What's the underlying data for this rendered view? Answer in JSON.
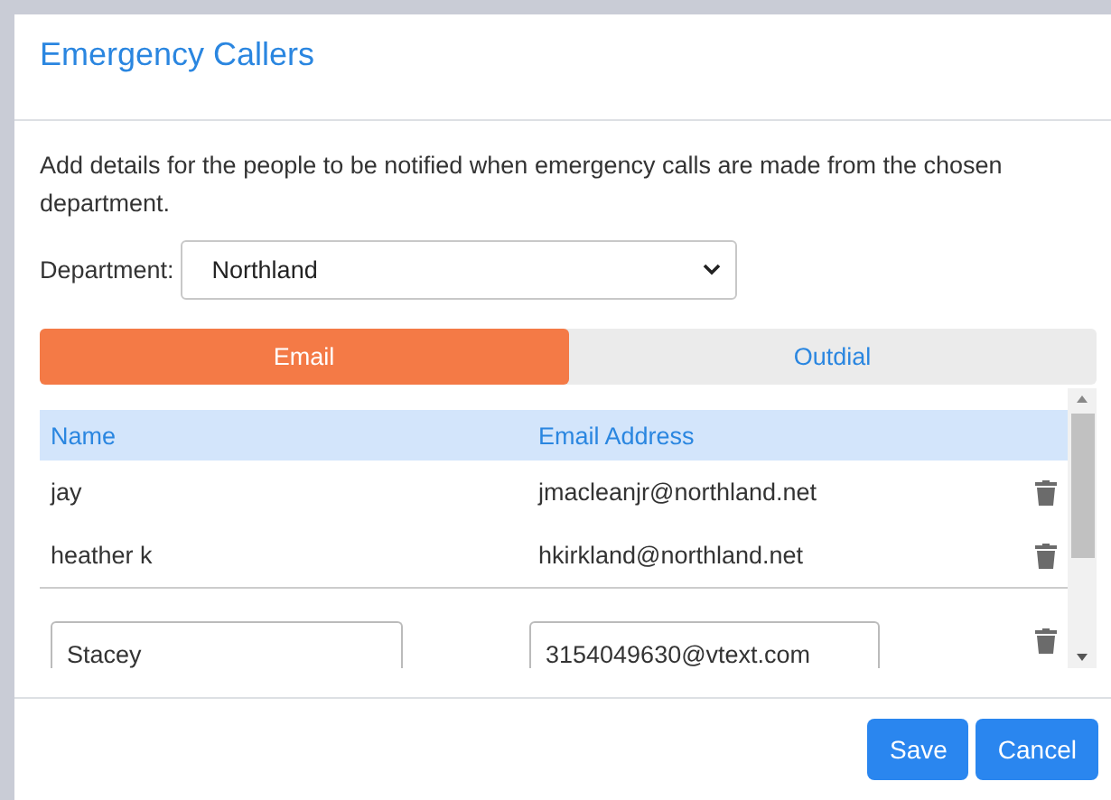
{
  "dialog": {
    "title": "Emergency Callers"
  },
  "description": "Add details for the people to be notified when emergency calls are made from the chosen department.",
  "department": {
    "label": "Department:",
    "value": "Northland"
  },
  "tabs": [
    {
      "label": "Email",
      "selected": true
    },
    {
      "label": "Outdial",
      "selected": false
    }
  ],
  "table": {
    "columns": [
      "Name",
      "Email Address"
    ],
    "rows": [
      {
        "kind": "text",
        "name": "jay",
        "email": "jmacleanjr@northland.net"
      },
      {
        "kind": "text",
        "name": "heather k",
        "email": "hkirkland@northland.net"
      },
      {
        "kind": "edit",
        "name": "Stacey",
        "email": "3154049630@vtext.com"
      }
    ]
  },
  "buttons": [
    "Save",
    "Cancel"
  ]
}
